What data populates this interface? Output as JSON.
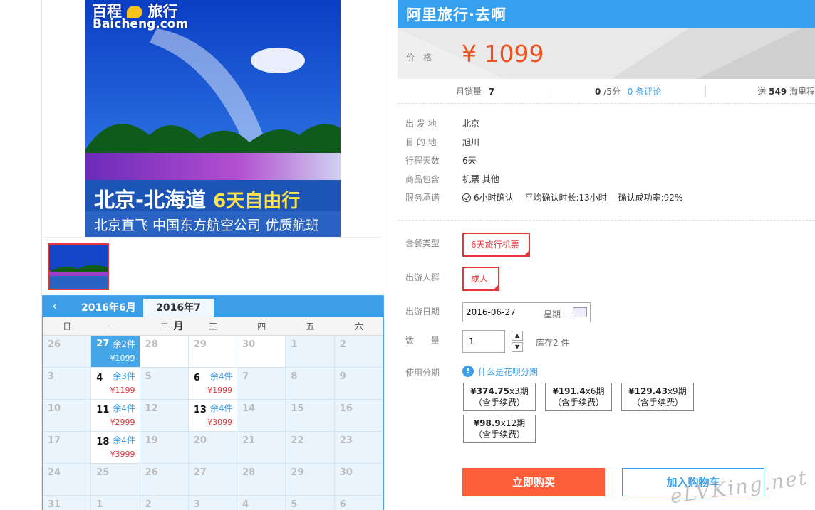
{
  "banner": {
    "logo_cn": "百程",
    "logo_cn2": "旅行",
    "logo_en": "Baicheng.com",
    "headline_a": "北京-北海道",
    "headline_b": "6天自由行",
    "subline": "北京直飞 中国东方航空公司 优质航班"
  },
  "calendar": {
    "tabs": [
      "2016年6月",
      "2016年7月"
    ],
    "weekdays": [
      "日",
      "一",
      "二",
      "三",
      "四",
      "五",
      "六"
    ],
    "cells": [
      {
        "day": "26",
        "state": "inactive"
      },
      {
        "day": "27",
        "state": "selected",
        "stock": "余2件",
        "price": "¥1099"
      },
      {
        "day": "28",
        "state": "plain"
      },
      {
        "day": "29",
        "state": "plain"
      },
      {
        "day": "30",
        "state": "plain"
      },
      {
        "day": "1",
        "state": "inactive"
      },
      {
        "day": "2",
        "state": "inactive"
      },
      {
        "day": "3",
        "state": "inactive"
      },
      {
        "day": "4",
        "state": "has",
        "stock": "余3件",
        "price": "¥1199"
      },
      {
        "day": "5",
        "state": "inactive"
      },
      {
        "day": "6",
        "state": "has",
        "stock": "余4件",
        "price": "¥1999"
      },
      {
        "day": "7",
        "state": "inactive"
      },
      {
        "day": "8",
        "state": "inactive"
      },
      {
        "day": "9",
        "state": "inactive"
      },
      {
        "day": "10",
        "state": "inactive"
      },
      {
        "day": "11",
        "state": "has",
        "stock": "余4件",
        "price": "¥2999"
      },
      {
        "day": "12",
        "state": "inactive"
      },
      {
        "day": "13",
        "state": "has",
        "stock": "余4件",
        "price": "¥3099"
      },
      {
        "day": "14",
        "state": "inactive"
      },
      {
        "day": "15",
        "state": "inactive"
      },
      {
        "day": "16",
        "state": "inactive"
      },
      {
        "day": "17",
        "state": "inactive"
      },
      {
        "day": "18",
        "state": "has",
        "stock": "余4件",
        "price": "¥3999"
      },
      {
        "day": "19",
        "state": "inactive"
      },
      {
        "day": "20",
        "state": "inactive"
      },
      {
        "day": "21",
        "state": "inactive"
      },
      {
        "day": "22",
        "state": "inactive"
      },
      {
        "day": "23",
        "state": "inactive"
      },
      {
        "day": "24",
        "state": "inactive"
      },
      {
        "day": "25",
        "state": "inactive"
      },
      {
        "day": "26",
        "state": "inactive"
      },
      {
        "day": "27",
        "state": "inactive"
      },
      {
        "day": "28",
        "state": "inactive"
      },
      {
        "day": "29",
        "state": "inactive"
      },
      {
        "day": "30",
        "state": "inactive"
      },
      {
        "day": "31",
        "state": "inactive"
      },
      {
        "day": "1",
        "state": "inactive"
      },
      {
        "day": "2",
        "state": "inactive"
      },
      {
        "day": "3",
        "state": "inactive"
      },
      {
        "day": "4",
        "state": "inactive"
      },
      {
        "day": "5",
        "state": "inactive"
      },
      {
        "day": "6",
        "state": "inactive"
      }
    ]
  },
  "hero": {
    "store_title": "阿里旅行·去啊",
    "price_label": "价格",
    "price_value": "¥ 1099"
  },
  "stats": {
    "monthly_sales_label": "月销量",
    "monthly_sales_value": "7",
    "rating_value": "0",
    "rating_suffix": "/5分",
    "reviews_link": "0 条评论",
    "points_prefix": "送",
    "points_value": "549",
    "points_suffix": "淘里程"
  },
  "attrs": [
    {
      "k": "出 发 地",
      "v": "北京"
    },
    {
      "k": "目 的 地",
      "v": "旭川"
    },
    {
      "k": "行程天数",
      "v": "6天"
    },
    {
      "k": "商品包含",
      "v": "机票  其他"
    }
  ],
  "service": {
    "label": "服务承诺",
    "confirm": "6小时确认",
    "avg_time": "平均确认时长:13小时",
    "success_rate": "确认成功率:92%"
  },
  "options": {
    "package_label": "套餐类型",
    "package_value": "6天旅行机票",
    "crowd_label": "出游人群",
    "crowd_value": "成人",
    "date_label": "出游日期",
    "date_value": "2016-06-27",
    "date_weekday": "星期一",
    "qty_label": "数  量",
    "qty_value": "1",
    "stock_text": "库存2 件",
    "installment_label": "使用分期",
    "installment_link": "什么是花呗分期",
    "installments": [
      {
        "amount": "¥374.75",
        "periods": "x3期",
        "fee": "（含手续费）"
      },
      {
        "amount": "¥191.4",
        "periods": "x6期",
        "fee": "（含手续费）"
      },
      {
        "amount": "¥129.43",
        "periods": "x9期",
        "fee": "（含手续费）"
      },
      {
        "amount": "¥98.9",
        "periods": "x12期",
        "fee": "（含手续费）"
      }
    ]
  },
  "actions": {
    "buy_now": "立即购买",
    "add_to_cart": "加入购物车"
  },
  "watermark": "eLVKing.net",
  "colors": {
    "accent_blue": "#35a0f0",
    "price_orange": "#f0521e",
    "buy_button": "#ff5e3a",
    "selected_red": "#e4393c"
  }
}
